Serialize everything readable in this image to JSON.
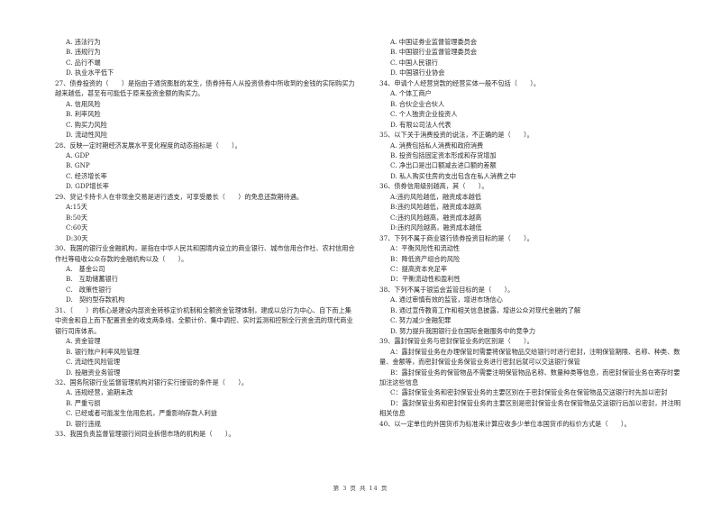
{
  "left_column": {
    "prev_options": [
      "A. 违法行为",
      "B. 违规行为",
      "C. 品行不端",
      "D. 执业水平低下"
    ],
    "questions": [
      {
        "stem": "27、债券投资的（　　）是指由于通货膨胀的发生，债券持有人从投资债券中所收到的金钱的实际购买力越来越低，甚至有可能低于原来投资金额的购买力。",
        "options": [
          "A. 信用风险",
          "B. 利率风险",
          "C. 购买力风险",
          "D. 流动性风险"
        ]
      },
      {
        "stem": "28、反映一定时期经济发展水平变化程度的动态指标是（　　）。",
        "options": [
          "A. GDP",
          "B. GNP",
          "C. 经济增长率",
          "D. GDP增长率"
        ]
      },
      {
        "stem": "29、贷记卡持卡人在非现金交易是进行透支，可享受最长（　　）的免息还款期待遇。",
        "options": [
          "A:15天",
          "B:50天",
          "C:60天",
          "D:30天"
        ]
      },
      {
        "stem": "30、我国的银行业金融机构，是指在中华人民共和国境内设立的商业银行、城市信用合作社、农村信用合作社等吸收公众存款的金融机构以及（　　）。",
        "options": [
          "A.　基金公司",
          "B.　互助储蓄银行",
          "C.　政策性银行",
          "D.　契约型存款机构"
        ]
      },
      {
        "stem": "31、（　　）的核心是建设内部资金转移定价机制和全额资金管理体制，建成以总行为中心、自下而上集中资金和自上而下配置资金的收支两条线、全额计价、集中调控、实时监测和控制全行资金流的现代商业银行司库体系。",
        "options": [
          "A. 资金管理",
          "B. 银行账户利率风险管理",
          "C. 流动性风险管理",
          "D. 投融资业务管理"
        ]
      },
      {
        "stem": "32、国务院银行业监督管理机构对银行实行接管的条件是（　　）。",
        "options": [
          "A. 违规经营，逾期未改",
          "B. 严重亏损",
          "C. 已经或者可能发生信用危机，严重影响存款人利益",
          "D. 银行违规"
        ]
      },
      {
        "stem": "33、我国负责监督管理银行间同业拆借市场的机构是（　　）。",
        "options": []
      }
    ]
  },
  "right_column": {
    "prev_options": [
      "A. 中国证券业监督管理委员会",
      "B. 中国银行业监督管理委员会",
      "C. 中国人民银行",
      "D. 中国银行业协会"
    ],
    "questions": [
      {
        "stem": "34、申请个人经营贷款的经营实体一般不包括（　　）。",
        "options": [
          "A. 个体工商户",
          "B. 合伙企业合伙人",
          "C. 个人独资企业投资人",
          "D. 有限公司法人代表"
        ]
      },
      {
        "stem": "35、以下关于消费投资的说法，不正确的是（　　）。",
        "options": [
          "A. 消费包括私人消费和政府消费",
          "B. 投资包括固定资本形成和存货增加",
          "C. 净出口是出口额减去进口额的差额",
          "D. 私人购买住房的支出包含在私人消费之中"
        ]
      },
      {
        "stem": "36、债券信用级别越高，其（　　）。",
        "options": [
          "A:违约风险越低，融资成本越低",
          "B:违约风险越低，融资成本越高",
          "C:违约风险越高，融资成本越高",
          "D:违约风险越高，融资成本越低"
        ]
      },
      {
        "stem": "37、下列不属于商业银行债券投资目标的是（　　）。",
        "options": [
          "A：平衡风险性和流动性",
          "B：降低资产组合的风险",
          "C：提高资本充足率",
          "D：平衡流动性和盈利性"
        ]
      },
      {
        "stem": "38、下列不属于银监会监管目标的是（　　）。",
        "options": [
          "A. 通过审慎有效的监管，增进市场信心",
          "B. 通过宣传教育工作和相关信息披露，增进公众对现代金融的了解",
          "C. 努力减少金融犯罪",
          "D. 努力提升我国银行业在国际金融服务中的竞争力"
        ]
      },
      {
        "stem": "39、露封保管业务与密封保管业务的区别是（　　）。",
        "long_options": [
          "A：露封保管业务在办理保管时需要将保管物品交给银行时进行密封，注明保管期限、名称、种类、数量、金额等，而密封保管业务保管业务进行密封后就可以交送银行保管",
          "B：露封保管业务的保管物品不需要注明保管物品名称、数量种类等信息，而密封保管业务在寄存时要加注这些信息",
          "C：露封保管业务和密封保管业务的主要区别在于密封保管业务在保管物品交送银行时先加以密封",
          "D：露封保管业务和密封保管业务的主要区别是密封保管业务在保管物品交送银行后加以密封，并注明相关信息"
        ]
      },
      {
        "stem": "40、以一定单位的外国货币为标准来计算应收多少单位本国货币的标价方式是（　　）。",
        "options": []
      }
    ]
  },
  "footer": {
    "page_label": "第 3 页 共 14 页"
  }
}
